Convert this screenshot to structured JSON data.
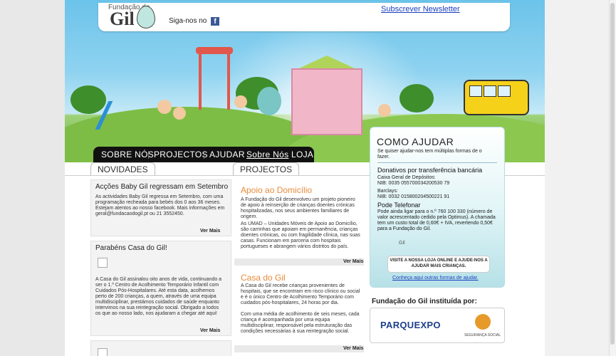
{
  "header": {
    "logo_top": "Fundação do",
    "logo_main": "Gil",
    "follow_label": "Siga-nos no",
    "facebook_icon": "f",
    "newsletter_link": "Subscrever Newsletter"
  },
  "nav": {
    "items": [
      "SOBRE NÓS",
      "PROJECTOS",
      "AJUDAR"
    ],
    "broken_image_alt": "Sobre Nós",
    "last_item": "LOJA"
  },
  "tabs": {
    "news": "NOVIDADES",
    "projects": "PROJECTOS"
  },
  "news": [
    {
      "title": "Acções Baby Gil regressam em Setembro",
      "body": "As actividades Baby Gil regressa em Setembro, com uma programação recheada para bebés dos 0 aos 36 meses. Estejam atentos ao nosso facebook. Mais informações em geral@fundacaodogil.pt ou 21 3552450.",
      "more": "Ver Mais"
    },
    {
      "title": "Parabéns Casa do Gil!",
      "body": "A Casa do Gil assinalou oito anos de vida, continuando a ser o 1.º Centro de Acolhimento Temporário Infantil com Cuidados Pós-Hospitalares. Até esta data, acolhemos perto de 200 crianças, a quem, através de uma equipa multidisciplinar, prestámos cuidados de saúde enquanto intervimos na sua reintegração social. Obrigado a todos os que ao nosso lado, nos ajudaram a chegar até aqui!",
      "more": "Ver Mais"
    }
  ],
  "projects": [
    {
      "title": "Apoio ao Domicílio",
      "body1": "A Fundação do Gil desenvolveu um projeto pioneiro de apoio à reinserção de crianças doentes crónicas hospitalizadas, nos seus ambientes familiares de origem.",
      "body2": "As UMAD – Unidades Móveis de Apoio ao Domicílio, são carrinhas que apoiam em permanência, crianças doentes crónicas, ou com fragilidade clínica, nas suas casas. Funcionam em parceria com hospitais portugueses e abrangem vários distritos do país.",
      "more": "Ver Mais"
    },
    {
      "title": "Casa do Gil",
      "body1": "A Casa do Gil recebe crianças provenientes de hospitais, que se encontram em risco clínico ou social e é o único Centro de Acolhimento Temporário com cuidados pós-hospitalares, 24 horas por dia.",
      "body2": "Com uma média de acolhimento de seis meses, cada criança é acompanhada por uma equipa multidisciplinar, responsável pela estruturação das condições necessárias à sua reintegração social.",
      "more": "Ver Mais"
    }
  ],
  "help": {
    "title": "COMO AJUDAR",
    "intro": "Se quiser ajudar-nos tem múltiplas formas de o fazer.",
    "donations_title": "Donativos por transferência bancária",
    "cgd": "Caixa Geral de Depósitos:",
    "cgd_nib": "NIB: 0035 055700034200530 79",
    "barclays": "Barclays:",
    "barclays_nib": "NIB: 0032 015800204500221 91",
    "phone_title": "Pode Telefonar",
    "phone_text": "Pode ainda ligar para o n.º 760 100 330 (número de valor acrescentado cedido pela Optimus). A chamada tem um custo total de 0,60€ + IVA, revertendo 0,50€ para a Fundação do Gil.",
    "gil_img_alt": "Gil",
    "shop_button": "VISITE A NOSSA LOJA ONLINE E AJUDE-NOS A AJUDAR MAIS CRIANÇAS.",
    "other_ways": "Conheça aqui outras formas de ajudar."
  },
  "foundation": {
    "title": "Fundação do Gil instituída por:",
    "sponsor1": "PARQUEXPO",
    "sponsor2": "SEGURANÇA SOCIAL"
  },
  "colors": {
    "accent_orange": "#e98a3a",
    "link_blue": "#1a3fc0",
    "nav_bg": "#111111"
  }
}
